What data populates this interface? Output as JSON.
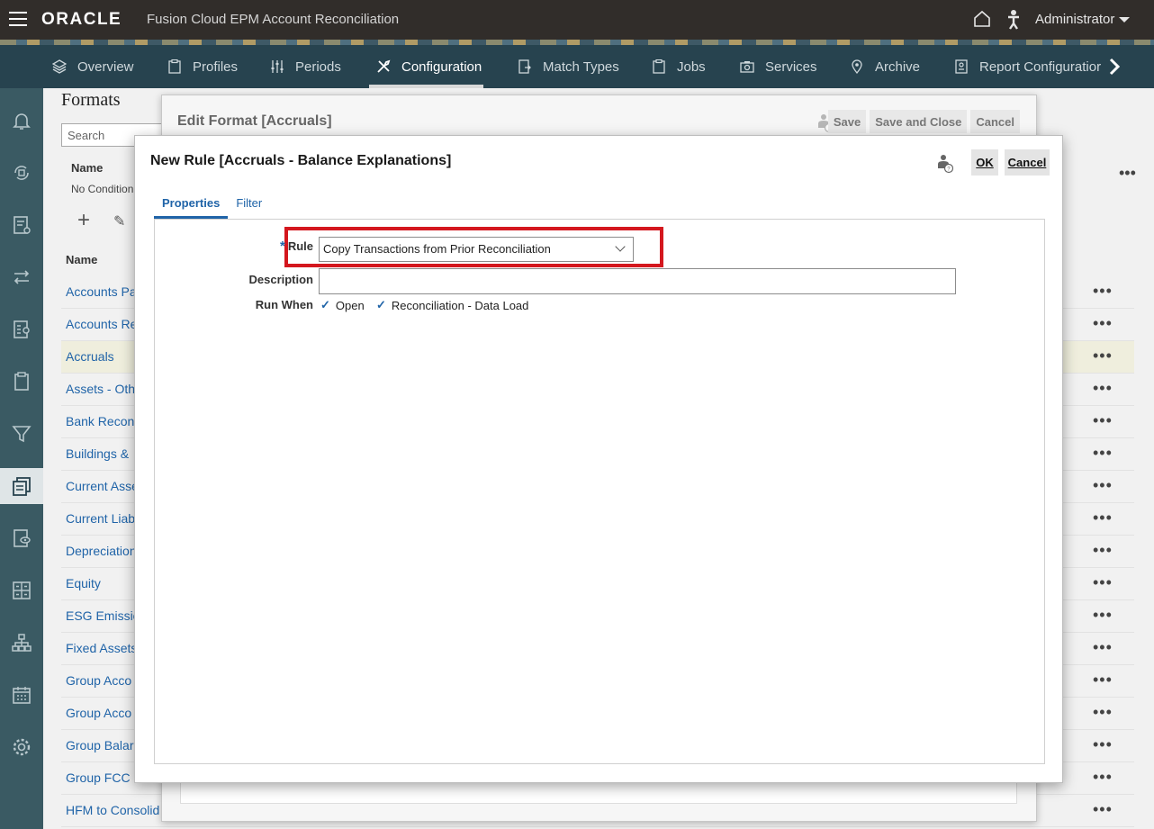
{
  "topbar": {
    "logo": "ORACLE",
    "app_title": "Fusion Cloud EPM Account Reconciliation",
    "user": "Administrator"
  },
  "nav": {
    "tabs": [
      {
        "label": "Overview",
        "icon": "overview-icon"
      },
      {
        "label": "Profiles",
        "icon": "clipboard-icon"
      },
      {
        "label": "Periods",
        "icon": "sliders-icon"
      },
      {
        "label": "Configuration",
        "icon": "tools-icon",
        "active": true
      },
      {
        "label": "Match Types",
        "icon": "match-icon"
      },
      {
        "label": "Jobs",
        "icon": "clipboard-icon"
      },
      {
        "label": "Services",
        "icon": "camera-icon"
      },
      {
        "label": "Archive",
        "icon": "pin-icon"
      },
      {
        "label": "Report Configuratior",
        "icon": "report-icon"
      }
    ]
  },
  "rail": {
    "items": [
      "bell-icon",
      "reconciliation-icon",
      "list-settings-icon",
      "transfer-icon",
      "report-settings-icon",
      "clipboard-icon",
      "filter-icon",
      "formats-icon",
      "view-icon",
      "grid-icon",
      "hierarchy-icon",
      "calendar-icon",
      "gear-icon"
    ],
    "active": 7
  },
  "background_page": {
    "title": "Formats",
    "search_placeholder": "Search",
    "filter_header": "Name",
    "no_condition": "No Condition",
    "column_name": "Name",
    "rows": [
      "Accounts Pa",
      "Accounts Re",
      "Accruals",
      "Assets - Oth",
      "Bank Recon",
      "Buildings &",
      "Current Asse",
      "Current Liab",
      "Depreciation",
      "Equity",
      "ESG Emissic",
      "Fixed Assets",
      "Group Acco",
      "Group Acco",
      "Group Balar",
      "Group FCC",
      "HFM to Consolid"
    ],
    "selected_row": 2,
    "row_action": "•••"
  },
  "edit_dialog": {
    "title": "Edit Format [Accruals]",
    "save": "Save",
    "save_close": "Save and Close",
    "cancel": "Cancel"
  },
  "rule_dialog": {
    "title": "New Rule [Accruals - Balance Explanations]",
    "ok": "OK",
    "cancel": "Cancel",
    "tabs": [
      "Properties",
      "Filter"
    ],
    "active_tab": 0,
    "required_mark": "*",
    "rule_label": "Rule",
    "rule_value": "Copy Transactions from Prior Reconciliation",
    "description_label": "Description",
    "description_value": "",
    "run_when_label": "Run When",
    "run_when_options": [
      {
        "label": "Open",
        "checked": true
      },
      {
        "label": "Reconciliation - Data Load",
        "checked": true
      }
    ],
    "highlight_color": "#d4171e"
  }
}
